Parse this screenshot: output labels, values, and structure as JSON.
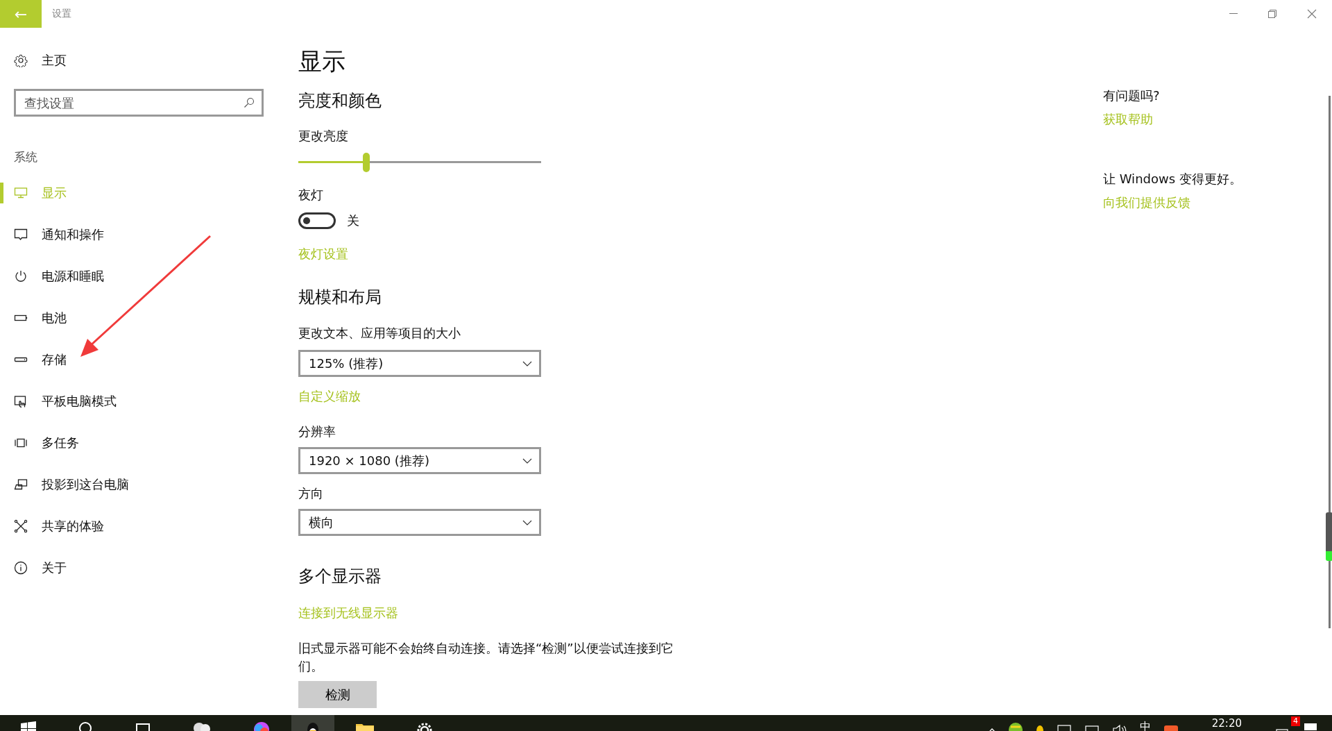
{
  "window": {
    "title": "设置",
    "back_button": "←"
  },
  "sidebar": {
    "home": "主页",
    "search": {
      "placeholder": "查找设置"
    },
    "section": "系统",
    "items": [
      {
        "label": "显示",
        "kind": "display",
        "selected": true
      },
      {
        "label": "通知和操作",
        "kind": "notify",
        "selected": false
      },
      {
        "label": "电源和睡眠",
        "kind": "power",
        "selected": false
      },
      {
        "label": "电池",
        "kind": "battery",
        "selected": false
      },
      {
        "label": "存储",
        "kind": "storage",
        "selected": false
      },
      {
        "label": "平板电脑模式",
        "kind": "tablet",
        "selected": false
      },
      {
        "label": "多任务",
        "kind": "multitask",
        "selected": false
      },
      {
        "label": "投影到这台电脑",
        "kind": "project",
        "selected": false
      },
      {
        "label": "共享的体验",
        "kind": "share",
        "selected": false
      },
      {
        "label": "关于",
        "kind": "about",
        "selected": false
      }
    ]
  },
  "main": {
    "title": "显示",
    "brightness_section": "亮度和颜色",
    "brightness": {
      "label": "更改亮度",
      "level": 0.28
    },
    "night_light": {
      "label": "夜灯",
      "on": false,
      "state_text": "关",
      "settings_link": "夜灯设置"
    },
    "layout_section": "规模和布局",
    "scale": {
      "label": "更改文本、应用等项目的大小",
      "value": "125% (推荐)",
      "link": "自定义缩放"
    },
    "resolution": {
      "label": "分辨率",
      "value": "1920 × 1080 (推荐)"
    },
    "orientation": {
      "label": "方向",
      "value": "横向"
    },
    "multi_section": "多个显示器",
    "wireless_link": "连接到无线显示器",
    "note": "旧式显示器可能不会始终自动连接。请选择“检测”以便尝试连接到它们。",
    "detect_button": "检测"
  },
  "help": {
    "question": "有问题吗?",
    "help_link": "获取帮助",
    "improve": "让 Windows 变得更好。",
    "feedback_link": "向我们提供反馈"
  },
  "taskbar": {
    "ime": "中",
    "time": "22:20",
    "notification_count": "4"
  }
}
